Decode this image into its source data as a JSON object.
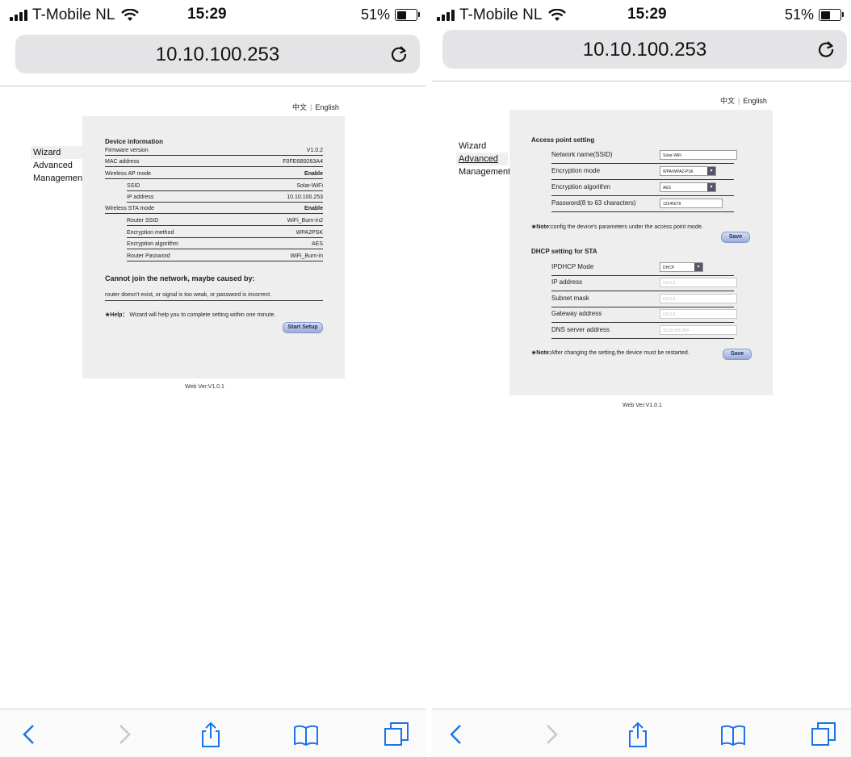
{
  "status_bar": {
    "carrier": "T-Mobile NL",
    "time": "15:29",
    "battery_percent": "51%",
    "battery_level": 0.51
  },
  "browser": {
    "url": "10.10.100.253"
  },
  "page_header": {
    "lang_chinese": "中文",
    "lang_english": "English"
  },
  "nav": {
    "items": [
      "Wizard",
      "Advanced",
      "Management"
    ]
  },
  "wizard_page": {
    "section_title": "Device information",
    "rows": [
      {
        "label": "Firmware version",
        "value": "V1.0.2"
      },
      {
        "label": "MAC address",
        "value": "F0FE6B9263A4"
      },
      {
        "label": "Wireless AP mode",
        "value": "Enable"
      },
      {
        "label": "SSID",
        "value": "Solar-WiFi"
      },
      {
        "label": "IP address",
        "value": "10.10.100.253"
      },
      {
        "label": "Wireless STA mode",
        "value": "Enable"
      },
      {
        "label": "Router SSID",
        "value": "WiFi_Burn-in2"
      },
      {
        "label": "Encryption method",
        "value": "WPA2PSK"
      },
      {
        "label": "Encryption algorithm",
        "value": "AES"
      },
      {
        "label": "Router Password",
        "value": "WiFi_Burn-in"
      }
    ],
    "cannot_join_title": "Cannot join the network,  maybe caused by:",
    "cannot_join_text": "router doesn't exist,  or signal is too weak,  or password is incorrect.",
    "help_label": "★Help：",
    "help_text": "Wizard will help you to complete setting within one minute.",
    "start_setup_button": "Start Setup"
  },
  "advanced_page": {
    "ap_title": "Access point setting",
    "ap_rows": [
      {
        "label": "Network name(SSID)",
        "value": "Solar-WiFi",
        "type": "text"
      },
      {
        "label": "Encryption mode",
        "value": "WPA/WPA2-PSK",
        "type": "select"
      },
      {
        "label": "Encryption algorithm",
        "value": "AES",
        "type": "select"
      },
      {
        "label": "Password(8 to 63 characters)",
        "value": "12345678",
        "type": "text"
      }
    ],
    "ap_note_label": "★Note:",
    "ap_note_text": "config the device's parameters under the access point mode.",
    "ap_save": "Save",
    "dhcp_title": "DHCP setting for STA",
    "dhcp_rows": [
      {
        "label": "IPDHCP Mode",
        "value": "DHCP",
        "type": "select"
      },
      {
        "label": "IP address",
        "value": "0.0.0.0",
        "type": "text"
      },
      {
        "label": "Subnet mask",
        "value": "0.0.0.0",
        "type": "text"
      },
      {
        "label": "Gateway address",
        "value": "0.0.0.0",
        "type": "text"
      },
      {
        "label": "DNS server address",
        "value": "10.10.100.254",
        "type": "text"
      }
    ],
    "dhcp_note_label": "★Note:",
    "dhcp_note_text": "After changing the setting,the device must be restarted.",
    "dhcp_save": "Save"
  },
  "footer": {
    "web_version": "Web Ver:V1.0.1"
  },
  "toolbar": {
    "icons": [
      "back-icon",
      "forward-icon",
      "share-icon",
      "bookmarks-icon",
      "tabs-icon"
    ]
  }
}
